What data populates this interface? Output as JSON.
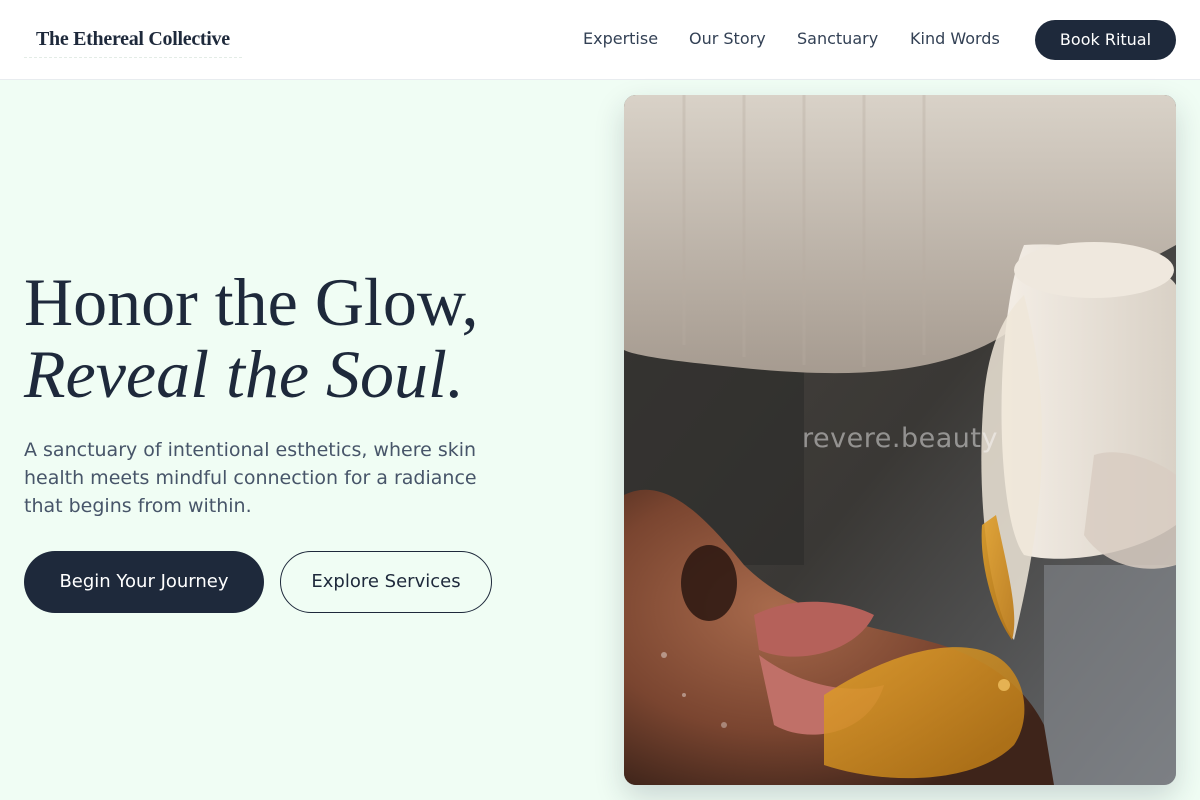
{
  "brand": {
    "name": "The Ethereal Collective"
  },
  "nav": {
    "items": [
      {
        "label": "Expertise"
      },
      {
        "label": "Our Story"
      },
      {
        "label": "Sanctuary"
      },
      {
        "label": "Kind Words"
      }
    ],
    "cta_label": "Book Ritual"
  },
  "hero": {
    "headline_line1": "Honor the Glow,",
    "headline_line2": "Reveal the Soul.",
    "subtext": "A sanctuary of intentional esthetics, where skin health meets mindful connection for a radiance that begins from within.",
    "primary_button": "Begin Your Journey",
    "secondary_button": "Explore Services",
    "image_watermark": "revere.beauty"
  },
  "colors": {
    "background": "#f0fdf4",
    "primary": "#1e293b",
    "text_muted": "#475569"
  }
}
